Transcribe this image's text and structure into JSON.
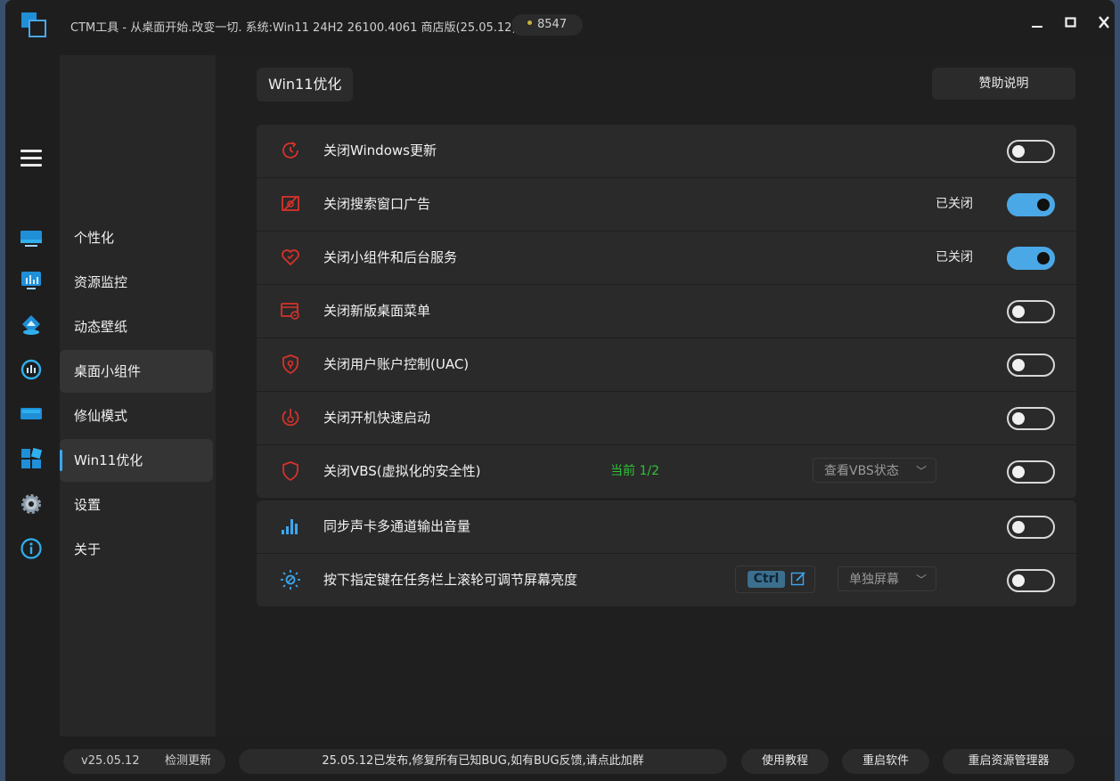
{
  "titlebar": {
    "title": "CTM工具 - 从桌面开始.改变一切. 系统:Win11 24H2 26100.4061 商店版(25.05.12)",
    "badge": "8547"
  },
  "menu": {
    "items": [
      {
        "label": "个性化"
      },
      {
        "label": "资源监控"
      },
      {
        "label": "动态壁纸"
      },
      {
        "label": "桌面小组件"
      },
      {
        "label": "修仙模式"
      },
      {
        "label": "Win11优化"
      },
      {
        "label": "设置"
      },
      {
        "label": "关于"
      }
    ],
    "active_index": 5
  },
  "page": {
    "title": "Win11优化",
    "help_button": "赞助说明"
  },
  "settings": {
    "group1": [
      {
        "label": "关闭Windows更新",
        "state_text": "",
        "on": false,
        "icon": "clock-update-icon"
      },
      {
        "label": "关闭搜索窗口广告",
        "state_text": "已关闭",
        "on": true,
        "icon": "no-ads-icon"
      },
      {
        "label": "关闭小组件和后台服务",
        "state_text": "已关闭",
        "on": true,
        "icon": "widgets-heart-icon"
      },
      {
        "label": "关闭新版桌面菜单",
        "state_text": "",
        "on": false,
        "icon": "desktop-menu-icon"
      },
      {
        "label": "关闭用户账户控制(UAC)",
        "state_text": "",
        "on": false,
        "icon": "uac-shield-icon"
      },
      {
        "label": "关闭开机快速启动",
        "state_text": "",
        "on": false,
        "icon": "fast-boot-icon"
      },
      {
        "label": "关闭VBS(虚拟化的安全性)",
        "state_text": "",
        "on": false,
        "icon": "vbs-shield-icon",
        "current": "当前 1/2",
        "dropdown": "查看VBS状态"
      }
    ],
    "group2": [
      {
        "label": "同步声卡多通道输出音量",
        "on": false,
        "icon": "equalizer-icon"
      },
      {
        "label": "按下指定键在任务栏上滚轮可调节屏幕亮度",
        "on": false,
        "icon": "brightness-icon",
        "key": "Ctrl",
        "dropdown": "单独屏幕"
      }
    ]
  },
  "footer": {
    "version": "v25.05.12",
    "check_update": "检测更新",
    "notice": "25.05.12已发布,修复所有已知BUG,如有BUG反馈,请点此加群",
    "tutorial": "使用教程",
    "restart_app": "重启软件",
    "restart_explorer": "重启资源管理器"
  },
  "colors": {
    "accent": "#4ba8e6",
    "icon_red": "#d8322b",
    "icon_blue": "#3aa7f0",
    "current_green": "#2ec23a"
  }
}
